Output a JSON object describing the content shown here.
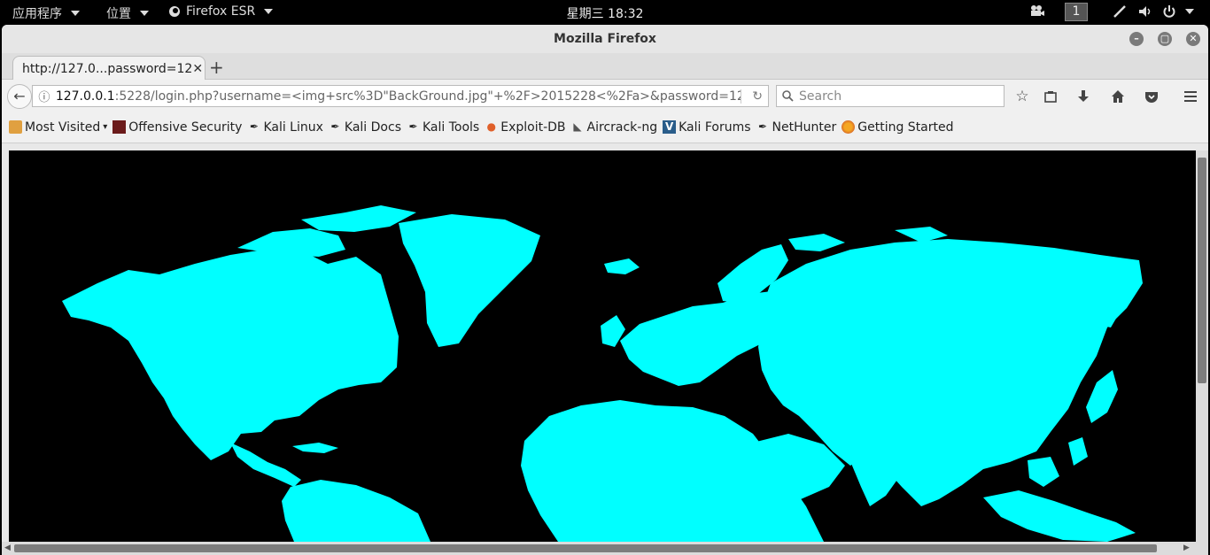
{
  "system_bar": {
    "apps_menu": "应用程序",
    "places_menu": "位置",
    "active_app": "Firefox ESR",
    "clock": "星期三 18:32",
    "workspace": "1"
  },
  "window": {
    "title": "Mozilla Firefox"
  },
  "tab": {
    "label": "http://127.0...password=12"
  },
  "url": {
    "host": "127.0.0.1",
    "rest": ":5228/login.php?username=<img+src%3D\"BackGround.jpg\"+%2F>2015228<%2Fa>&password=12"
  },
  "search": {
    "placeholder": "Search"
  },
  "bookmarks": [
    {
      "label": "Most Visited",
      "icon": "folder-icon"
    },
    {
      "label": "Offensive Security",
      "icon": "offsec-icon"
    },
    {
      "label": "Kali Linux",
      "icon": "kali-icon"
    },
    {
      "label": "Kali Docs",
      "icon": "kali-icon"
    },
    {
      "label": "Kali Tools",
      "icon": "kali-icon"
    },
    {
      "label": "Exploit-DB",
      "icon": "exploitdb-icon"
    },
    {
      "label": "Aircrack-ng",
      "icon": "aircrack-icon"
    },
    {
      "label": "Kali Forums",
      "icon": "forums-icon"
    },
    {
      "label": "NetHunter",
      "icon": "kali-icon"
    },
    {
      "label": "Getting Started",
      "icon": "firefox-icon"
    }
  ],
  "page": {
    "map_fill": "#00ffff",
    "map_background": "#000000"
  }
}
